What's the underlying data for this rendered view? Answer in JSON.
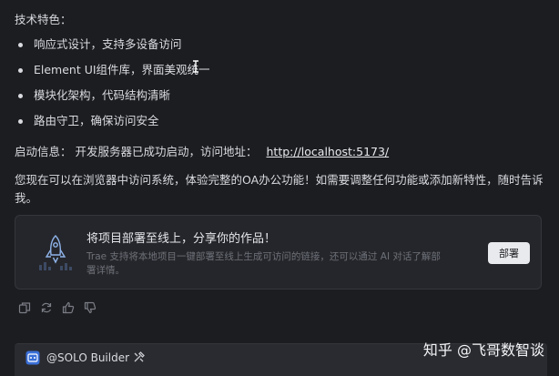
{
  "heading": "技术特色：",
  "features": [
    "响应式设计，支持多设备访问",
    "Element UI组件库，界面美观统一",
    "模块化架构，代码结构清晰",
    "路由守卫，确保访问安全"
  ],
  "startup": {
    "label": "启动信息：",
    "text": "开发服务器已成功启动，访问地址：",
    "url": "http://localhost:5173/"
  },
  "summary": "您现在可以在浏览器中访问系统，体验完整的OA办公功能！如需要调整任何功能或添加新特性，随时告诉我。",
  "deploy_card": {
    "title": "将项目部署至线上，分享你的作品！",
    "description": "Trae 支持将本地项目一键部署至线上生成可访问的链接，还可以通过 AI 对话了解部署详情。",
    "button_label": "部署",
    "icon": "rocket-icon"
  },
  "actions": [
    "copy-icon",
    "regenerate-icon",
    "thumbs-up-icon",
    "thumbs-down-icon"
  ],
  "builder": {
    "label": "@SOLO Builder",
    "icon": "builder-icon",
    "tool_icon": "tools-icon"
  },
  "watermark": "知乎 @飞哥数智谈"
}
